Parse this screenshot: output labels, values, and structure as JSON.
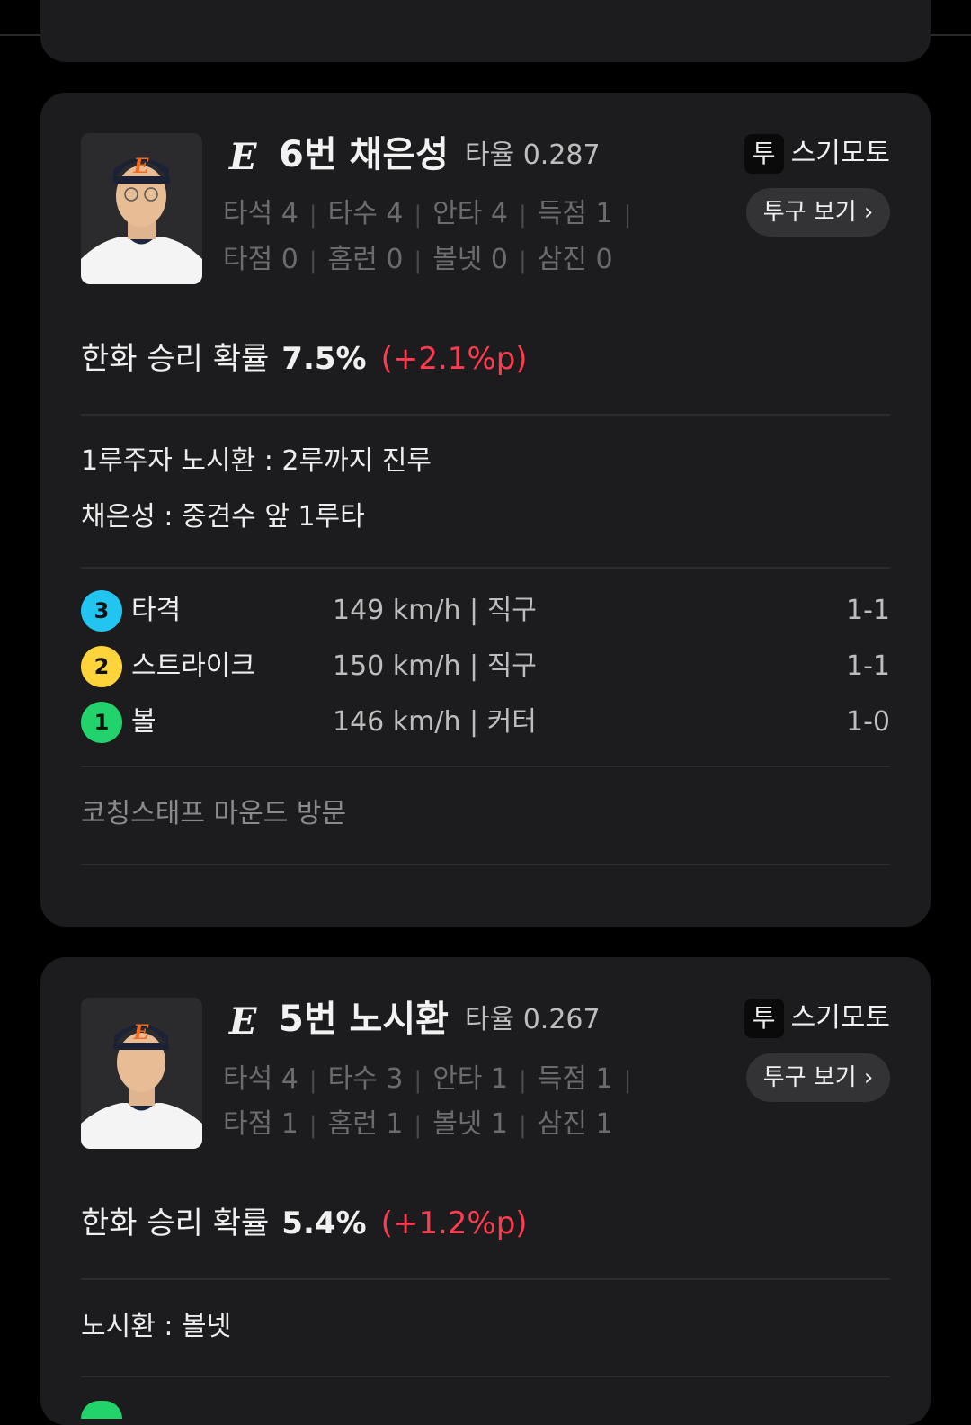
{
  "colors": {
    "background": "#000000",
    "card": "#1c1c1e",
    "delta_positive": "#ff3b4e",
    "pitch_cyan": "#22c4f0",
    "pitch_yellow": "#ffd43b",
    "pitch_green": "#22d36b"
  },
  "cards": [
    {
      "team_logo": "E",
      "player_name": "6번 채은성",
      "avg_label": "타율 0.287",
      "pitcher_badge": "투",
      "pitcher_name": "스기모토",
      "pitch_button": "투구 보기 ›",
      "stats_line1": [
        "타석 4",
        "타수 4",
        "안타 4",
        "득점 1"
      ],
      "stats_line2": [
        "타점 0",
        "홈런 0",
        "볼넷 0",
        "삼진 0"
      ],
      "win_label": "한화 승리 확률",
      "win_pct": "7.5%",
      "win_delta": "(+2.1%p)",
      "plays": [
        "1루주자 노시환 : 2루까지 진루",
        "채은성 : 중견수 앞 1루타"
      ],
      "pitches": [
        {
          "num": "3",
          "result": "타격",
          "speed": "149 km/h | 직구",
          "count": "1-1",
          "color": "#22c4f0"
        },
        {
          "num": "2",
          "result": "스트라이크",
          "speed": "150 km/h | 직구",
          "count": "1-1",
          "color": "#ffd43b"
        },
        {
          "num": "1",
          "result": "볼",
          "speed": "146 km/h | 커터",
          "count": "1-0",
          "color": "#22d36b"
        }
      ],
      "event": "코칭스태프 마운드 방문"
    },
    {
      "team_logo": "E",
      "player_name": "5번 노시환",
      "avg_label": "타율 0.267",
      "pitcher_badge": "투",
      "pitcher_name": "스기모토",
      "pitch_button": "투구 보기 ›",
      "stats_line1": [
        "타석 4",
        "타수 3",
        "안타 1",
        "득점 1"
      ],
      "stats_line2": [
        "타점 1",
        "홈런 1",
        "볼넷 1",
        "삼진 1"
      ],
      "win_label": "한화 승리 확률",
      "win_pct": "5.4%",
      "win_delta": "(+1.2%p)",
      "plays": [
        "노시환 : 볼넷"
      ]
    }
  ]
}
